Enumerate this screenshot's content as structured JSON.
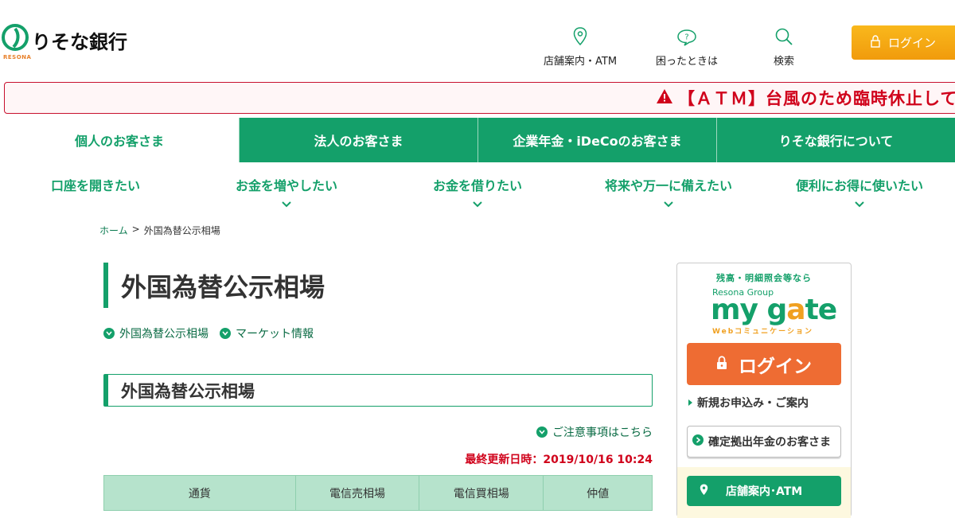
{
  "header": {
    "logo_text": "りそな銀行",
    "logo_sub": "RESONA",
    "nav": [
      {
        "label": "店舗案内・ATM",
        "icon": "map-pin-icon"
      },
      {
        "label": "困ったときは",
        "icon": "help-bubble-icon"
      },
      {
        "label": "検索",
        "icon": "search-icon"
      }
    ],
    "login_label": "ログイン"
  },
  "alert": {
    "text": "【ＡＴＭ】台風のため臨時休止して",
    "icon": "warning-icon"
  },
  "main_nav": [
    {
      "label": "個人のお客さま",
      "active": true
    },
    {
      "label": "法人のお客さま",
      "active": false
    },
    {
      "label": "企業年金・iDeCoのお客さま",
      "active": false
    },
    {
      "label": "りそな銀行について",
      "active": false
    }
  ],
  "sub_nav": [
    {
      "label": "口座を開きたい",
      "has_dropdown": false
    },
    {
      "label": "お金を増やしたい",
      "has_dropdown": true
    },
    {
      "label": "お金を借りたい",
      "has_dropdown": true
    },
    {
      "label": "将来や万一に備えたい",
      "has_dropdown": true
    },
    {
      "label": "便利にお得に使いたい",
      "has_dropdown": true
    }
  ],
  "breadcrumb": {
    "home": "ホーム",
    "separator": ">",
    "current": "外国為替公示相場"
  },
  "content": {
    "page_title": "外国為替公示相場",
    "anchors": [
      "外国為替公示相場",
      "マーケット情報"
    ],
    "section_title": "外国為替公示相場",
    "notice_link": "ご注意事項はこちら",
    "updated": "最終更新日時：2019/10/16 10:24",
    "table_headers": [
      "通貨",
      "電信売相場",
      "電信買相場",
      "仲値"
    ]
  },
  "sidebar": {
    "mygate_top": "残高・明細照会等なら",
    "mygate_group": "Resona Group",
    "mygate_logo_a": "my g",
    "mygate_logo_b": "a",
    "mygate_logo_c": "te",
    "mygate_sub": "Webコミュニケーション",
    "login_label": "ログイン",
    "apply_label": "新規お申込み・ご案内",
    "pension_label": "確定拠出年金のお客さま",
    "atm_label": "店舗案内･ATM"
  },
  "colors": {
    "brand_green": "#14a06a",
    "login_orange": "#f19b0c",
    "mygate_orange": "#ee6c33",
    "alert_red": "#d0021b"
  }
}
